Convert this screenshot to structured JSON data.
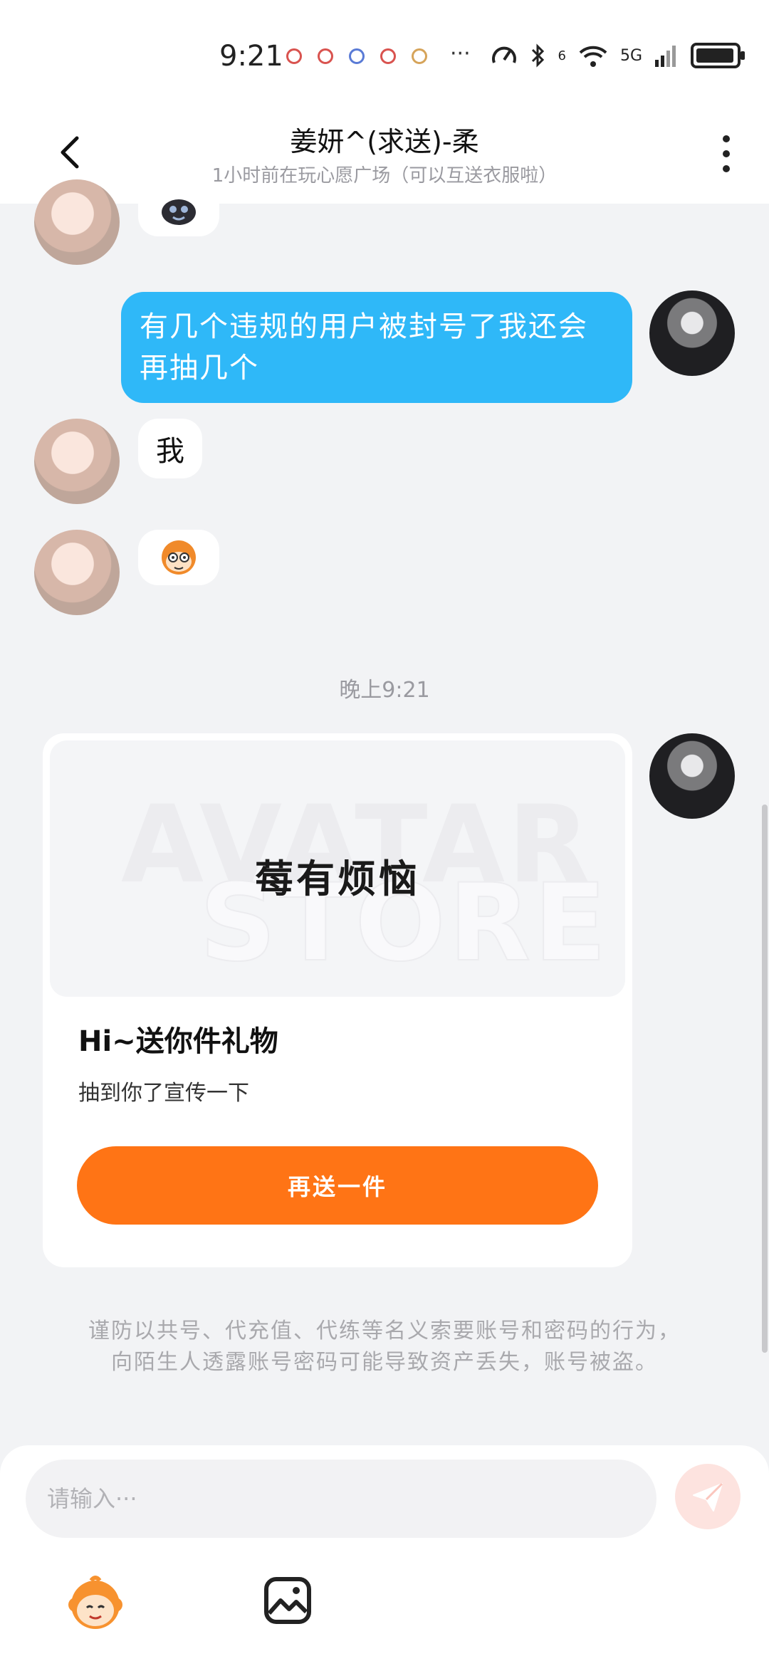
{
  "status": {
    "time": "9:21",
    "more": "···",
    "network": "5G",
    "signal_label": "6"
  },
  "header": {
    "title": "姜妍^(求送)-柔",
    "subtitle": "1小时前在玩心愿广场（可以互送衣服啦）",
    "back_icon": "chevron-left-icon",
    "more_icon": "more-vertical-icon"
  },
  "messages": [
    {
      "from": "them",
      "type": "sticker",
      "sticker": "black-face-emoji"
    },
    {
      "from": "me",
      "type": "text",
      "text": "有几个违规的用户被封号了我还会再抽几个"
    },
    {
      "from": "them",
      "type": "text",
      "text": "我"
    },
    {
      "from": "them",
      "type": "sticker",
      "sticker": "monkey-face-emoji"
    }
  ],
  "time_separator": "晚上9:21",
  "gift_card": {
    "watermark_line1": "AVATAR",
    "watermark_line2": "STORE",
    "gift_name": "莓有烦恼",
    "title": "Hi~送你件礼物",
    "description": "抽到你了宣传一下",
    "button": "再送一件"
  },
  "warning": "谨防以共号、代充值、代练等名义索要账号和密码的行为，向陌生人透露账号密码可能导致资产丢失，账号被盗。",
  "composer": {
    "placeholder": "请输入···",
    "send_icon": "send-icon",
    "emoji_icon": "monkey-emoji-icon",
    "image_icon": "image-icon"
  },
  "colors": {
    "outgoing_bubble": "#2fb8f8",
    "gift_button": "#ff7415",
    "background": "#f2f3f5"
  }
}
